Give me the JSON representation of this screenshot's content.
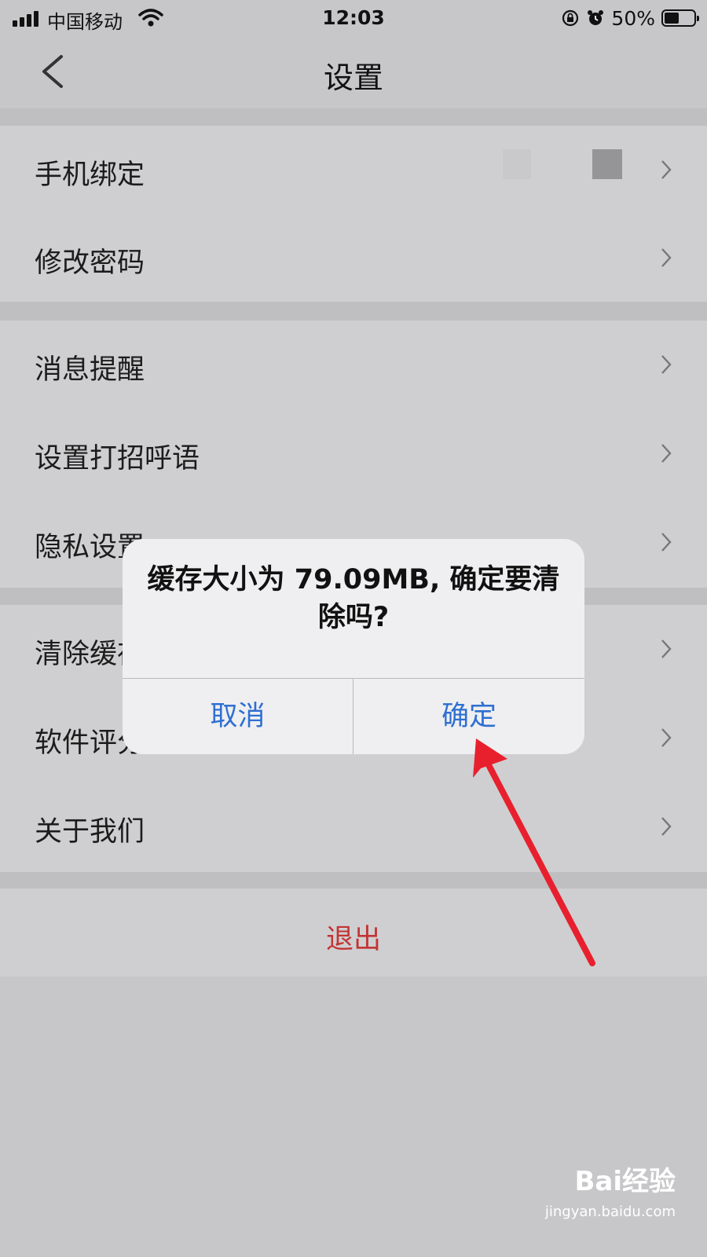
{
  "status_bar": {
    "carrier": "中国移动",
    "time": "12:03",
    "battery_percent": "50%",
    "battery_level": 0.5
  },
  "header": {
    "title": "设置",
    "back_icon": "chevron-left-icon"
  },
  "settings": {
    "group1": [
      {
        "label": "手机绑定"
      },
      {
        "label": "修改密码"
      }
    ],
    "group2": [
      {
        "label": "消息提醒"
      },
      {
        "label": "设置打招呼语"
      },
      {
        "label": "隐私设置"
      }
    ],
    "group3": [
      {
        "label": "清除缓存"
      },
      {
        "label": "软件评分"
      },
      {
        "label": "关于我们"
      }
    ],
    "logout_label": "退出"
  },
  "dialog": {
    "message": "缓存大小为 79.09MB, 确定要清除吗?",
    "cancel_label": "取消",
    "confirm_label": "确定"
  },
  "watermark": {
    "logo_text": "Bai经验",
    "url": "jingyan.baidu.com"
  },
  "colors": {
    "accent_blue": "#2f6fd1",
    "logout_red": "#c33434",
    "annotation_arrow": "#e8202e"
  }
}
